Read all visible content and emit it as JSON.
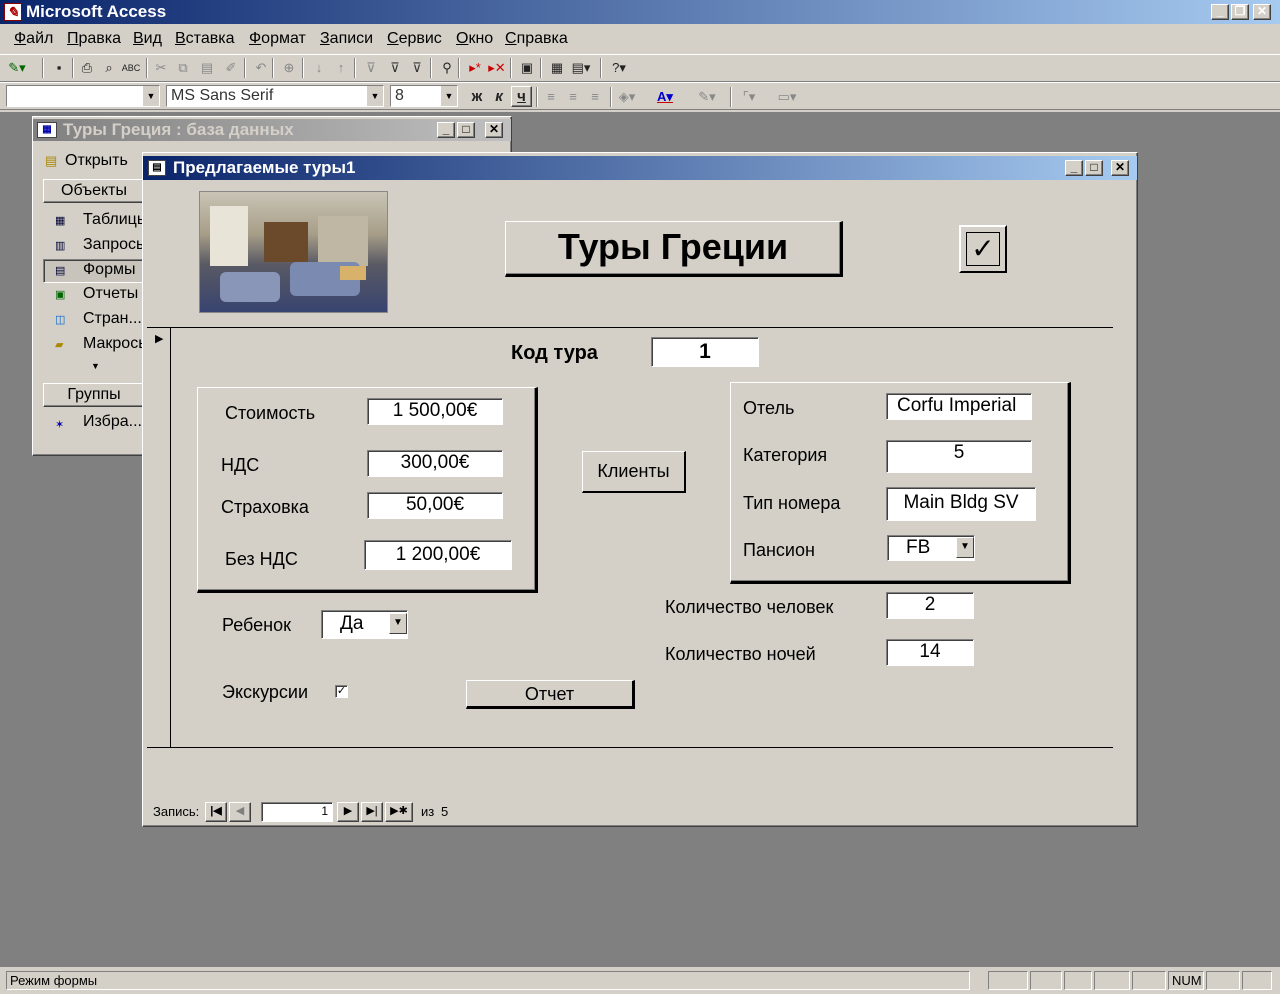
{
  "app": {
    "title": "Microsoft Access"
  },
  "menu": [
    "Файл",
    "Правка",
    "Вид",
    "Вставка",
    "Формат",
    "Записи",
    "Сервис",
    "Окно",
    "Справка"
  ],
  "format_toolbar": {
    "object_combo": "",
    "font": "MS Sans Serif",
    "size": "8",
    "bold": "ж",
    "italic": "к",
    "underline": "ч"
  },
  "db_window": {
    "title": "Туры Греция : база данных",
    "open_label": "Открыть",
    "objects_header": "Объекты",
    "objects": [
      "Таблицы",
      "Запросы",
      "Формы",
      "Отчеты",
      "Стран...",
      "Макросы"
    ],
    "groups_header": "Группы",
    "groups": [
      "Избра..."
    ]
  },
  "form_window": {
    "title": "Предлагаемые туры1",
    "heading": "Туры Греции",
    "check_glyph": "✓",
    "tour_code": {
      "label": "Код тура",
      "value": "1"
    },
    "cost": {
      "label": "Стоимость",
      "value": "1 500,00€"
    },
    "vat": {
      "label": "НДС",
      "value": "300,00€"
    },
    "insurance": {
      "label": "Страховка",
      "value": "50,00€"
    },
    "no_vat": {
      "label": "Без НДС",
      "value": "1 200,00€"
    },
    "clients_button": "Клиенты",
    "hotel": {
      "label": "Отель",
      "value": "Corfu Imperial"
    },
    "category": {
      "label": "Категория",
      "value": "5"
    },
    "room_type": {
      "label": "Тип номера",
      "value": "Main Bldg SV"
    },
    "board": {
      "label": "Пансион",
      "value": "FB"
    },
    "persons": {
      "label": "Количество человек",
      "value": "2"
    },
    "nights": {
      "label": "Количество ночей",
      "value": "14"
    },
    "child": {
      "label": "Ребенок",
      "value": "Да"
    },
    "excursions": {
      "label": "Экскурсии",
      "checked": true
    },
    "report_button": "Отчет",
    "nav": {
      "label": "Запись:",
      "current": "1",
      "of_label": "из",
      "total": "5"
    }
  },
  "status": {
    "text": "Режим формы",
    "num": "NUM"
  },
  "colors": {
    "title_active": "#0a246a",
    "title_gradient_end": "#a6caf0",
    "face": "#d4d0c8",
    "mdi": "#808080"
  }
}
